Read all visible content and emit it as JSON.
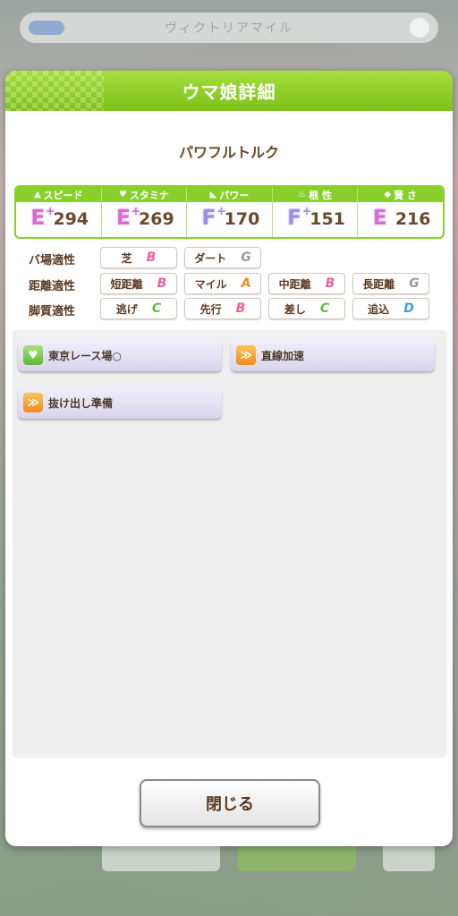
{
  "background": {
    "search_text": "ヴィクトリアマイル"
  },
  "dialog": {
    "title": "ウマ娘詳細",
    "uma_name": "パワフルトルク",
    "stats": [
      {
        "label": "スピード",
        "icon": "shoe-icon",
        "grade": "E",
        "plus": true,
        "value": "294"
      },
      {
        "label": "スタミナ",
        "icon": "heart-icon",
        "grade": "E",
        "plus": true,
        "value": "269"
      },
      {
        "label": "パワー",
        "icon": "muscle-icon",
        "grade": "F",
        "plus": true,
        "value": "170"
      },
      {
        "label": "根 性",
        "icon": "flame-icon",
        "grade": "F",
        "plus": true,
        "value": "151"
      },
      {
        "label": "賢 さ",
        "icon": "graduation-cap-icon",
        "grade": "E",
        "plus": false,
        "value": "216"
      }
    ],
    "aptitudes": {
      "track": {
        "label": "バ場適性",
        "items": [
          {
            "name": "芝",
            "grade": "B"
          },
          {
            "name": "ダート",
            "grade": "G"
          }
        ]
      },
      "distance": {
        "label": "距離適性",
        "items": [
          {
            "name": "短距離",
            "grade": "B"
          },
          {
            "name": "マイル",
            "grade": "A"
          },
          {
            "name": "中距離",
            "grade": "B"
          },
          {
            "name": "長距離",
            "grade": "G"
          }
        ]
      },
      "style": {
        "label": "脚質適性",
        "items": [
          {
            "name": "逃げ",
            "grade": "C"
          },
          {
            "name": "先行",
            "grade": "B"
          },
          {
            "name": "差し",
            "grade": "C"
          },
          {
            "name": "追込",
            "grade": "D"
          }
        ]
      }
    },
    "skills": [
      {
        "name": "東京レース場○",
        "icon": "heart-skill-icon",
        "color": "#5cb83a"
      },
      {
        "name": "直線加速",
        "icon": "speed-skill-icon",
        "color": "#f08a1e"
      },
      {
        "name": "抜け出し準備",
        "icon": "speed-skill-icon",
        "color": "#f08a1e"
      }
    ],
    "close_label": "閉じる"
  },
  "colors": {
    "header_green": "#8bcf2c",
    "text_brown": "#6b4a2a"
  }
}
